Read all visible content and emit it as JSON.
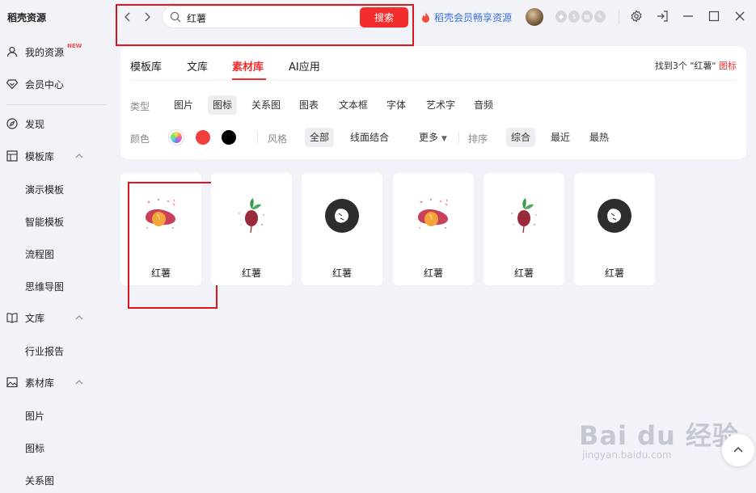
{
  "app_title": "稻壳资源",
  "sidebar": {
    "items": [
      {
        "label": "我的资源",
        "badge": "NEW"
      },
      {
        "label": "会员中心"
      },
      {
        "label": "发现"
      },
      {
        "label": "模板库"
      },
      {
        "label": "演示模板"
      },
      {
        "label": "智能模板"
      },
      {
        "label": "流程图"
      },
      {
        "label": "思维导图"
      },
      {
        "label": "文库"
      },
      {
        "label": "行业报告"
      },
      {
        "label": "素材库"
      },
      {
        "label": "图片"
      },
      {
        "label": "图标"
      },
      {
        "label": "关系图"
      }
    ]
  },
  "topbar": {
    "search_value": "红薯",
    "search_button": "搜索",
    "vip_link": "稻壳会员畅享资源"
  },
  "tabs": [
    {
      "label": "模板库"
    },
    {
      "label": "文库"
    },
    {
      "label": "素材库",
      "active": true
    },
    {
      "label": "AI应用"
    }
  ],
  "result": {
    "prefix": "找到3个 \"红薯\" ",
    "category": "图标"
  },
  "filters": {
    "type_label": "类型",
    "types": [
      "图片",
      "图标",
      "关系图",
      "图表",
      "文本框",
      "字体",
      "艺术字",
      "音频"
    ],
    "type_selected": "图标",
    "color_label": "颜色",
    "colors": [
      "#f03e3e",
      "#000000"
    ],
    "style_label": "风格",
    "styles": [
      "全部",
      "线面结合"
    ],
    "style_selected": "全部",
    "more": "更多",
    "sort_label": "排序",
    "sorts": [
      "综合",
      "最近",
      "最热"
    ],
    "sort_selected": "综合"
  },
  "cards": [
    {
      "title": "红薯",
      "icon": "sweet-potato-icon"
    },
    {
      "title": "红薯",
      "icon": "beet-icon"
    },
    {
      "title": "红薯",
      "icon": "dark-circle-sweet-potato-icon"
    },
    {
      "title": "红薯",
      "icon": "sweet-potato-icon"
    },
    {
      "title": "红薯",
      "icon": "beet-icon"
    },
    {
      "title": "红薯",
      "icon": "dark-circle-sweet-potato-icon"
    }
  ],
  "watermark": {
    "brand": "Bai du 经验",
    "url": "jingyan.baidu.com"
  }
}
